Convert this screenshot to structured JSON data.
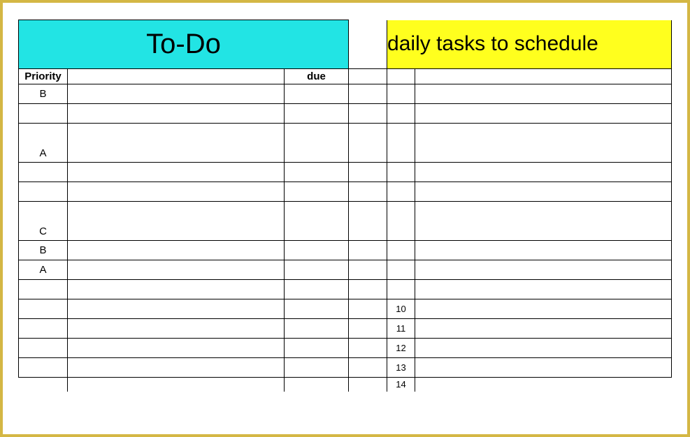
{
  "header": {
    "todo_title": "To-Do",
    "schedule_title": "daily tasks to schedule"
  },
  "columns": {
    "priority": "Priority",
    "due": "due"
  },
  "rows": [
    {
      "priority": "B",
      "task": "",
      "due": "",
      "num": "",
      "sched": ""
    },
    {
      "priority": "",
      "task": "",
      "due": "",
      "num": "",
      "sched": ""
    },
    {
      "priority": "A",
      "task": "",
      "due": "",
      "num": "",
      "sched": ""
    },
    {
      "priority": "",
      "task": "",
      "due": "",
      "num": "",
      "sched": ""
    },
    {
      "priority": "",
      "task": "",
      "due": "",
      "num": "",
      "sched": ""
    },
    {
      "priority": "C",
      "task": "",
      "due": "",
      "num": "",
      "sched": ""
    },
    {
      "priority": "B",
      "task": "",
      "due": "",
      "num": "",
      "sched": ""
    },
    {
      "priority": "A",
      "task": "",
      "due": "",
      "num": "",
      "sched": ""
    },
    {
      "priority": "",
      "task": "",
      "due": "",
      "num": "",
      "sched": ""
    },
    {
      "priority": "",
      "task": "",
      "due": "",
      "num": "10",
      "sched": ""
    },
    {
      "priority": "",
      "task": "",
      "due": "",
      "num": "11",
      "sched": ""
    },
    {
      "priority": "",
      "task": "",
      "due": "",
      "num": "12",
      "sched": ""
    },
    {
      "priority": "",
      "task": "",
      "due": "",
      "num": "13",
      "sched": ""
    },
    {
      "priority": "",
      "task": "",
      "due": "",
      "num": "14",
      "sched": ""
    }
  ]
}
